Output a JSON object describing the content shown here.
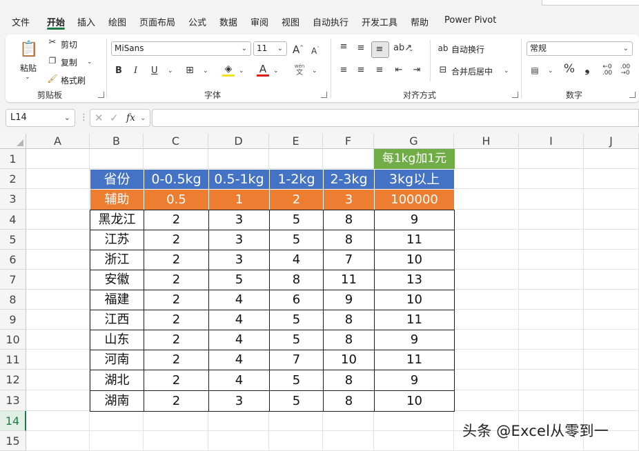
{
  "menu": {
    "tabs": [
      "文件",
      "开始",
      "插入",
      "绘图",
      "页面布局",
      "公式",
      "数据",
      "审阅",
      "视图",
      "自动执行",
      "开发工具",
      "帮助",
      "Power Pivot"
    ],
    "active": "开始"
  },
  "ribbon": {
    "clipboard": {
      "paste": "粘贴",
      "cut": "剪切",
      "copy": "复制",
      "format_painter": "格式刷",
      "group_label": "剪贴板"
    },
    "font": {
      "font_name": "MiSans",
      "font_size": "11",
      "group_label": "字体",
      "bold": "B",
      "italic": "I",
      "underline": "U",
      "phonetic_top": "wén",
      "phonetic_bottom": "文"
    },
    "alignment": {
      "wrap_text": "自动换行",
      "merge_center": "合并后居中",
      "group_label": "对齐方式"
    },
    "number": {
      "format": "常规",
      "group_label": "数字",
      "percent": "%",
      "comma": "❟"
    }
  },
  "formula_bar": {
    "name_box": "L14",
    "fx": "fx",
    "formula": ""
  },
  "columns": [
    "A",
    "B",
    "C",
    "D",
    "E",
    "F",
    "G",
    "H",
    "I",
    "J"
  ],
  "rows": [
    "1",
    "2",
    "3",
    "4",
    "5",
    "6",
    "7",
    "8",
    "9",
    "10",
    "11",
    "12",
    "13",
    "14",
    "15"
  ],
  "selected_row": "14",
  "note": "每1kg加1元",
  "table": {
    "header": [
      "省份",
      "0-0.5kg",
      "0.5-1kg",
      "1-2kg",
      "2-3kg",
      "3kg以上"
    ],
    "aux": [
      "辅助",
      "0.5",
      "1",
      "2",
      "3",
      "100000"
    ],
    "rows": [
      [
        "黑龙江",
        "2",
        "3",
        "5",
        "8",
        "9"
      ],
      [
        "江苏",
        "2",
        "3",
        "5",
        "8",
        "11"
      ],
      [
        "浙江",
        "2",
        "3",
        "4",
        "7",
        "10"
      ],
      [
        "安徽",
        "2",
        "5",
        "8",
        "11",
        "13"
      ],
      [
        "福建",
        "2",
        "4",
        "6",
        "9",
        "10"
      ],
      [
        "江西",
        "2",
        "4",
        "5",
        "8",
        "11"
      ],
      [
        "山东",
        "2",
        "4",
        "5",
        "8",
        "9"
      ],
      [
        "河南",
        "2",
        "4",
        "7",
        "10",
        "11"
      ],
      [
        "湖北",
        "2",
        "4",
        "5",
        "8",
        "9"
      ],
      [
        "湖南",
        "2",
        "3",
        "5",
        "8",
        "10"
      ]
    ]
  },
  "watermark": "头条 @Excel从零到一",
  "colors": {
    "header_blue": "#4472c4",
    "aux_orange": "#ed7d31",
    "note_green": "#70ad47",
    "accent": "#1d7a46"
  }
}
